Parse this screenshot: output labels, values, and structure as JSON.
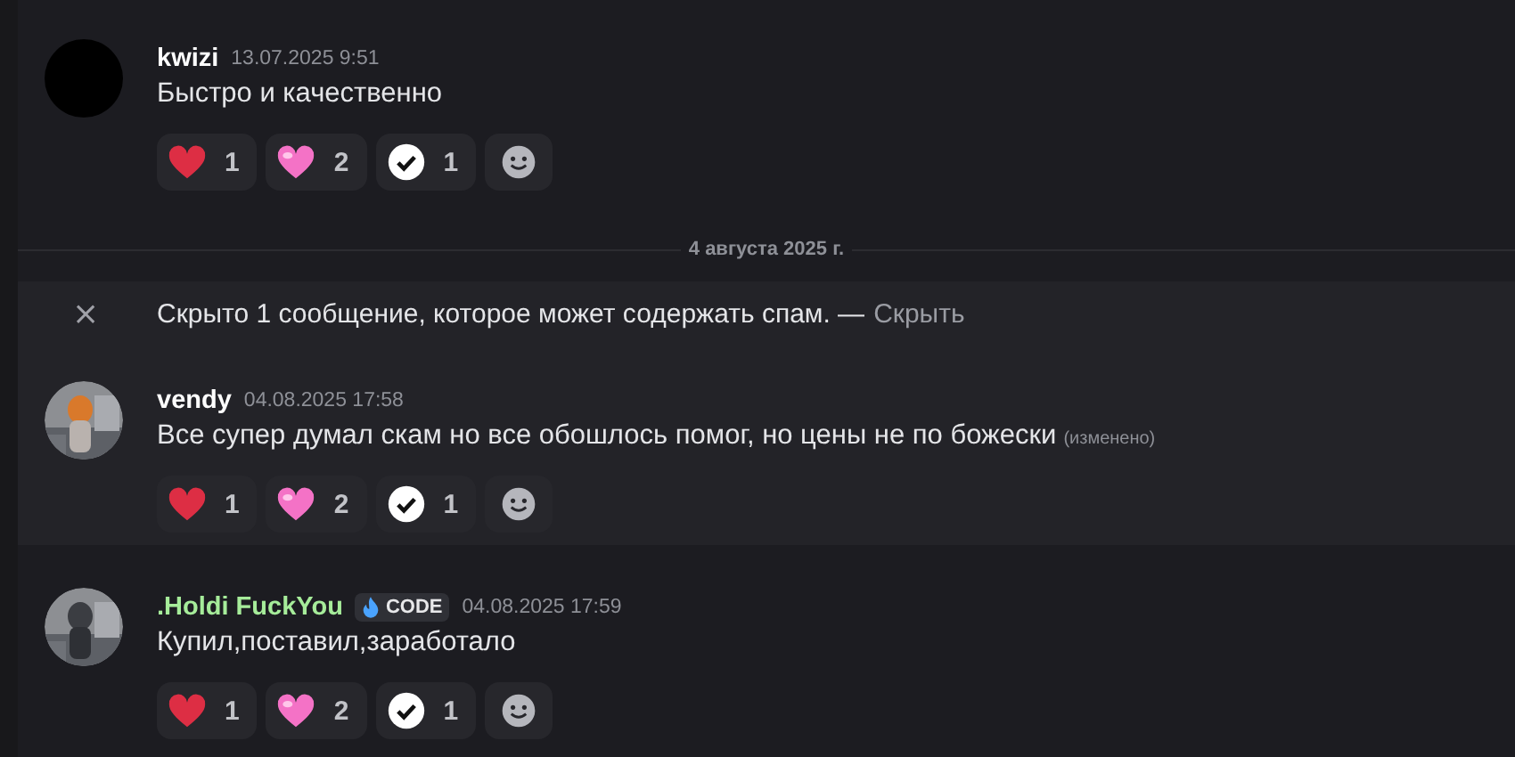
{
  "feed": [
    {
      "kind": "message",
      "highlighted": false,
      "author": "kwizi",
      "color": "#ffffff",
      "avatar": {
        "kind": "plain"
      },
      "time": "13.07.2025 9:51",
      "text": "Быстро и качественно",
      "reactions": [
        {
          "kind": "heart_red",
          "count": "1"
        },
        {
          "kind": "heart_pink",
          "count": "2"
        },
        {
          "kind": "check",
          "count": "1"
        },
        {
          "kind": "add"
        }
      ]
    },
    {
      "kind": "divider",
      "label": "4 августа 2025 г."
    },
    {
      "kind": "spam_notice",
      "close": "×",
      "text": "Скрыто 1 сообщение, которое может содержать спам. —",
      "link": "Скрыть"
    },
    {
      "kind": "message",
      "highlighted": true,
      "author": "vendy",
      "color": "#ffffff",
      "avatar": {
        "kind": "picture"
      },
      "time": "04.08.2025 17:58",
      "text": "Все супер думал скам но все обошлось помог, но цены не по божески",
      "edited": "(изменено)",
      "reactions": [
        {
          "kind": "heart_red",
          "count": "1"
        },
        {
          "kind": "heart_pink",
          "count": "2"
        },
        {
          "kind": "check",
          "count": "1"
        },
        {
          "kind": "add"
        }
      ]
    },
    {
      "kind": "message",
      "highlighted": false,
      "author": ".Holdi FuckYou",
      "color": "#a6ec9a",
      "avatar": {
        "kind": "picture"
      },
      "tag": "CODE",
      "time": "04.08.2025 17:59",
      "text": "Купил,поставил,заработало",
      "reactions": [
        {
          "kind": "heart_red",
          "count": "1"
        },
        {
          "kind": "heart_pink",
          "count": "2"
        },
        {
          "kind": "check",
          "count": "1"
        },
        {
          "kind": "add"
        }
      ]
    }
  ]
}
